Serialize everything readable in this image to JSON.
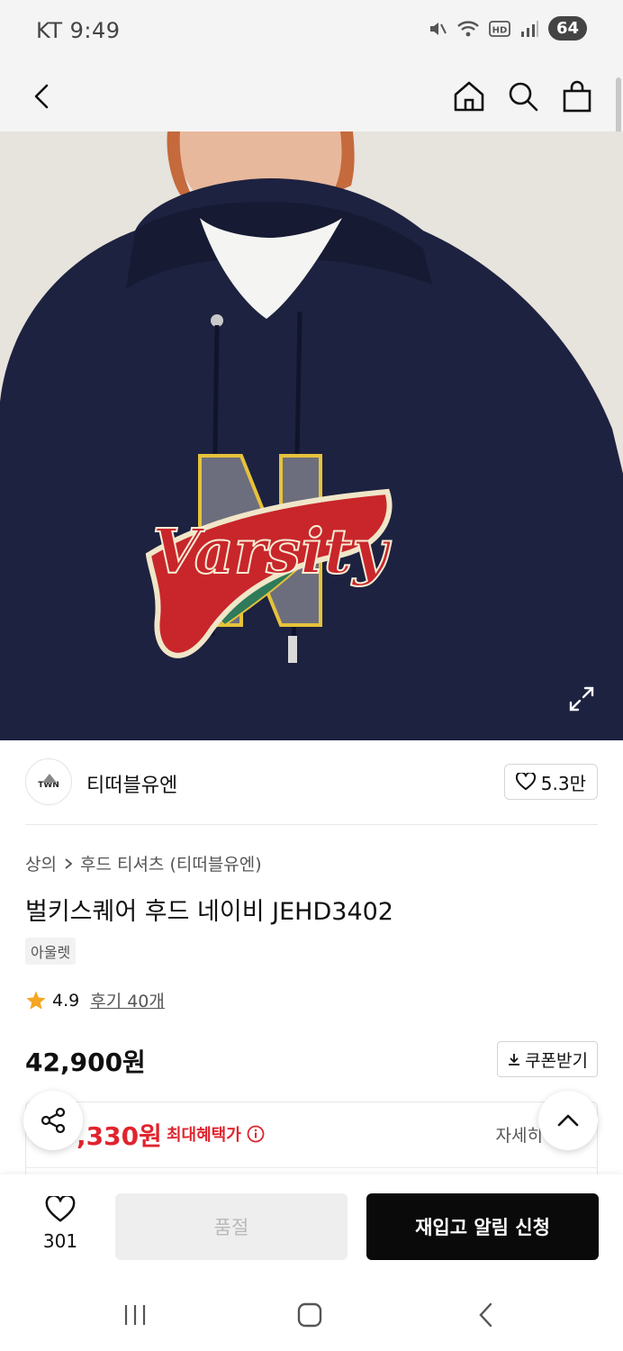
{
  "status": {
    "carrier_time": "KT 9:49",
    "battery": "64"
  },
  "appbar": {
    "icons": [
      "back-icon",
      "home-icon",
      "search-icon",
      "bag-icon"
    ]
  },
  "hero": {
    "patch_text": "Varsity",
    "patch_letter": "N"
  },
  "brand": {
    "logo_text": "TWN",
    "name": "티떠블유엔",
    "likes": "5.3만"
  },
  "product": {
    "breadcrumb": [
      "상의",
      "후드 티셔츠 (티떠블유엔)"
    ],
    "title": "벌키스퀘어 후드 네이비 JEHD3402",
    "tag": "아울렛",
    "rating": "4.9",
    "reviews": "후기 40개",
    "price": "42,900원",
    "coupon_label": "쿠폰받기"
  },
  "benefit": {
    "price": ",330원",
    "label": "최대혜택가",
    "detail": "자세히"
  },
  "buybar": {
    "wish_count": "301",
    "soldout_label": "품절",
    "restock_label": "재입고 알림 신청"
  },
  "colors": {
    "accent_red": "#e0242e",
    "hoodie_navy": "#1d2240",
    "patch_red": "#c8262b"
  }
}
